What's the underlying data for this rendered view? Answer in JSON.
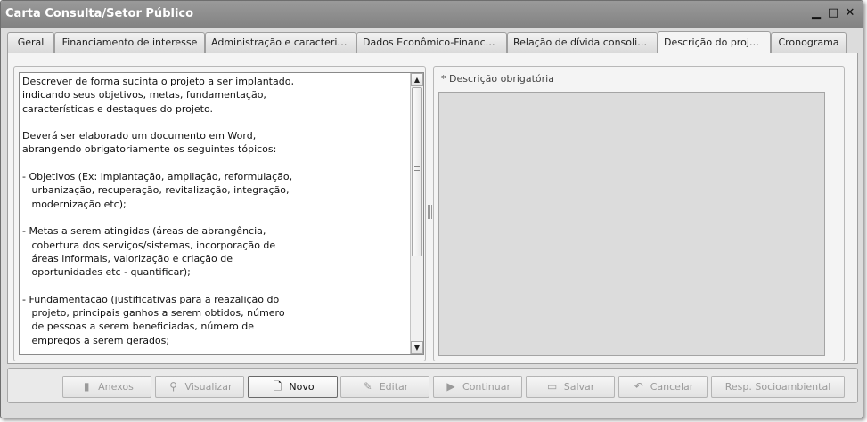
{
  "window": {
    "title": "Carta Consulta/Setor Público",
    "controls": {
      "minimize": "▁",
      "maximize": "□",
      "close": "✕"
    }
  },
  "tabs": [
    {
      "label": "Geral",
      "active": false
    },
    {
      "label": "Financiamento de interesse",
      "active": false
    },
    {
      "label": "Administração e caracteriza...",
      "active": false
    },
    {
      "label": "Dados Econômico-Financeiros",
      "active": false
    },
    {
      "label": "Relação de dívida consolida...",
      "active": false
    },
    {
      "label": "Descrição do projeto",
      "active": true
    },
    {
      "label": "Cronograma",
      "active": false
    }
  ],
  "instructions": {
    "text": "Descrever de forma sucinta o projeto a ser implantado,\nindicando seus objetivos, metas, fundamentação,\ncaracterísticas e destaques do projeto.\n\nDeverá ser elaborado um documento em Word,\nabrangendo obrigatoriamente os seguintes tópicos:\n\n- Objetivos (Ex: implantação, ampliação, reformulação,\n   urbanização, recuperação, revitalização, integração,\n   modernização etc);\n\n- Metas a serem atingidas (áreas de abrangência,\n   cobertura dos serviços/sistemas, incorporação de\n   áreas informais, valorização e criação de\n   oportunidades etc - quantificar);\n\n- Fundamentação (justificativas para a reazalição do\n   projeto, principais ganhos a serem obtidos, número\n   de pessoas a serem beneficiadas, número de\n   empregos a serem gerados;"
  },
  "description": {
    "label": "* Descrição obrigatória"
  },
  "scrollbar": {
    "up": "▲",
    "down": "▼"
  },
  "buttons": [
    {
      "label": "Anexos",
      "icon": "attachment-icon",
      "glyph": "▮",
      "enabled": false
    },
    {
      "label": "Visualizar",
      "icon": "magnifier-icon",
      "glyph": "⚲",
      "enabled": false
    },
    {
      "label": "Novo",
      "icon": "new-document-icon",
      "glyph": "🗋",
      "enabled": true
    },
    {
      "label": "Editar",
      "icon": "pencil-icon",
      "glyph": "✎",
      "enabled": false
    },
    {
      "label": "Continuar",
      "icon": "play-icon",
      "glyph": "▶",
      "enabled": false
    },
    {
      "label": "Salvar",
      "icon": "floppy-icon",
      "glyph": "▭",
      "enabled": false
    },
    {
      "label": "Cancelar",
      "icon": "undo-icon",
      "glyph": "↶",
      "enabled": false
    },
    {
      "label": "Resp. Socioambiental",
      "icon": "",
      "glyph": "",
      "enabled": false
    }
  ]
}
